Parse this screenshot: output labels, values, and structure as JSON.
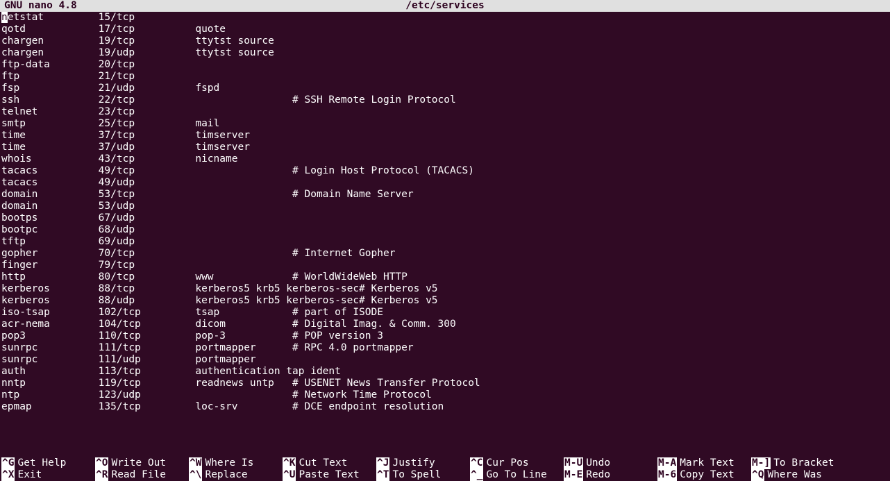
{
  "titlebar": {
    "app": "GNU nano 4.8",
    "filename": "/etc/services"
  },
  "lines": [
    {
      "svc": "netstat",
      "port": "15/tcp",
      "alias": "",
      "comment": ""
    },
    {
      "svc": "qotd",
      "port": "17/tcp",
      "alias": "quote",
      "comment": ""
    },
    {
      "svc": "chargen",
      "port": "19/tcp",
      "alias": "ttytst source",
      "comment": ""
    },
    {
      "svc": "chargen",
      "port": "19/udp",
      "alias": "ttytst source",
      "comment": ""
    },
    {
      "svc": "ftp-data",
      "port": "20/tcp",
      "alias": "",
      "comment": ""
    },
    {
      "svc": "ftp",
      "port": "21/tcp",
      "alias": "",
      "comment": ""
    },
    {
      "svc": "fsp",
      "port": "21/udp",
      "alias": "fspd",
      "comment": ""
    },
    {
      "svc": "ssh",
      "port": "22/tcp",
      "alias": "",
      "comment": "# SSH Remote Login Protocol"
    },
    {
      "svc": "telnet",
      "port": "23/tcp",
      "alias": "",
      "comment": ""
    },
    {
      "svc": "smtp",
      "port": "25/tcp",
      "alias": "mail",
      "comment": ""
    },
    {
      "svc": "time",
      "port": "37/tcp",
      "alias": "timserver",
      "comment": ""
    },
    {
      "svc": "time",
      "port": "37/udp",
      "alias": "timserver",
      "comment": ""
    },
    {
      "svc": "whois",
      "port": "43/tcp",
      "alias": "nicname",
      "comment": ""
    },
    {
      "svc": "tacacs",
      "port": "49/tcp",
      "alias": "",
      "comment": "# Login Host Protocol (TACACS)"
    },
    {
      "svc": "tacacs",
      "port": "49/udp",
      "alias": "",
      "comment": ""
    },
    {
      "svc": "domain",
      "port": "53/tcp",
      "alias": "",
      "comment": "# Domain Name Server"
    },
    {
      "svc": "domain",
      "port": "53/udp",
      "alias": "",
      "comment": ""
    },
    {
      "svc": "bootps",
      "port": "67/udp",
      "alias": "",
      "comment": ""
    },
    {
      "svc": "bootpc",
      "port": "68/udp",
      "alias": "",
      "comment": ""
    },
    {
      "svc": "tftp",
      "port": "69/udp",
      "alias": "",
      "comment": ""
    },
    {
      "svc": "gopher",
      "port": "70/tcp",
      "alias": "",
      "comment": "# Internet Gopher"
    },
    {
      "svc": "finger",
      "port": "79/tcp",
      "alias": "",
      "comment": ""
    },
    {
      "svc": "http",
      "port": "80/tcp",
      "alias": "www",
      "comment": "# WorldWideWeb HTTP"
    },
    {
      "svc": "kerberos",
      "port": "88/tcp",
      "alias": "kerberos5 krb5 kerberos-sec",
      "comment": "# Kerberos v5"
    },
    {
      "svc": "kerberos",
      "port": "88/udp",
      "alias": "kerberos5 krb5 kerberos-sec",
      "comment": "# Kerberos v5"
    },
    {
      "svc": "iso-tsap",
      "port": "102/tcp",
      "alias": "tsap",
      "comment": "# part of ISODE"
    },
    {
      "svc": "acr-nema",
      "port": "104/tcp",
      "alias": "dicom",
      "comment": "# Digital Imag. & Comm. 300"
    },
    {
      "svc": "pop3",
      "port": "110/tcp",
      "alias": "pop-3",
      "comment": "# POP version 3"
    },
    {
      "svc": "sunrpc",
      "port": "111/tcp",
      "alias": "portmapper",
      "comment": "# RPC 4.0 portmapper"
    },
    {
      "svc": "sunrpc",
      "port": "111/udp",
      "alias": "portmapper",
      "comment": ""
    },
    {
      "svc": "auth",
      "port": "113/tcp",
      "alias": "authentication tap ident",
      "comment": ""
    },
    {
      "svc": "nntp",
      "port": "119/tcp",
      "alias": "readnews untp",
      "comment": "# USENET News Transfer Protocol"
    },
    {
      "svc": "ntp",
      "port": "123/udp",
      "alias": "",
      "comment": "# Network Time Protocol"
    },
    {
      "svc": "epmap",
      "port": "135/tcp",
      "alias": "loc-srv",
      "comment": "# DCE endpoint resolution"
    }
  ],
  "shortcuts": {
    "row1": [
      {
        "key": "^G",
        "label": "Get Help"
      },
      {
        "key": "^O",
        "label": "Write Out"
      },
      {
        "key": "^W",
        "label": "Where Is"
      },
      {
        "key": "^K",
        "label": "Cut Text"
      },
      {
        "key": "^J",
        "label": "Justify"
      },
      {
        "key": "^C",
        "label": "Cur Pos"
      },
      {
        "key": "M-U",
        "label": "Undo"
      },
      {
        "key": "M-A",
        "label": "Mark Text"
      },
      {
        "key": "M-]",
        "label": "To Bracket"
      }
    ],
    "row2": [
      {
        "key": "^X",
        "label": "Exit"
      },
      {
        "key": "^R",
        "label": "Read File"
      },
      {
        "key": "^\\",
        "label": "Replace"
      },
      {
        "key": "^U",
        "label": "Paste Text"
      },
      {
        "key": "^T",
        "label": "To Spell"
      },
      {
        "key": "^_",
        "label": "Go To Line"
      },
      {
        "key": "M-E",
        "label": "Redo"
      },
      {
        "key": "M-6",
        "label": "Copy Text"
      },
      {
        "key": "^Q",
        "label": "Where Was"
      }
    ]
  }
}
